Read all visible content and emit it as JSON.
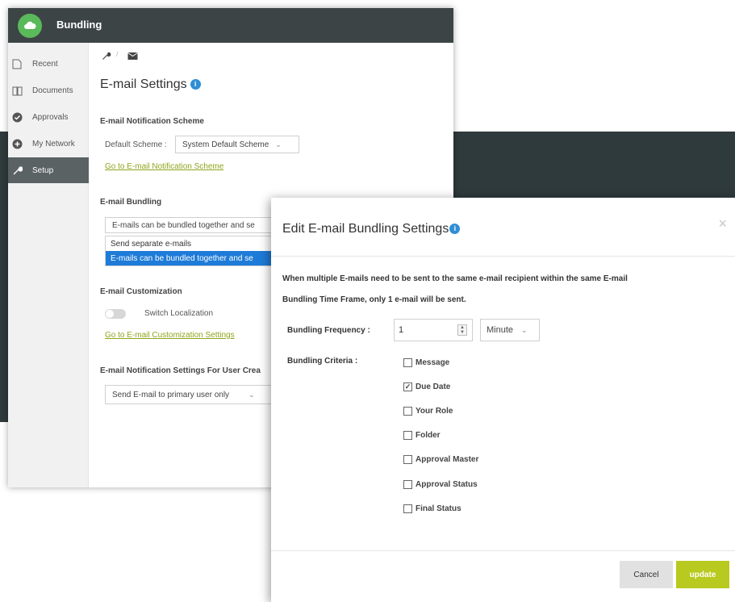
{
  "app": {
    "title": "Bundling"
  },
  "sidebar": {
    "items": [
      {
        "label": "Recent",
        "icon": "file-icon"
      },
      {
        "label": "Documents",
        "icon": "book-icon"
      },
      {
        "label": "Approvals",
        "icon": "check-circle-icon"
      },
      {
        "label": "My Network",
        "icon": "plus-circle-icon"
      },
      {
        "label": "Setup",
        "icon": "wrench-icon",
        "active": true
      }
    ]
  },
  "toolbar": {
    "icons": [
      "wrench-icon",
      "mail-icon"
    ]
  },
  "email_settings": {
    "title": "E-mail Settings",
    "notification_scheme": {
      "section_title": "E-mail Notification Scheme",
      "default_label": "Default Scheme :",
      "default_value": "System Default Scheme",
      "link": "Go to E-mail Notification Scheme"
    },
    "bundling": {
      "section_title": "E-mail Bundling",
      "select_value": "E-mails can be bundled together and se",
      "options": [
        "Send separate e-mails",
        "E-mails can be bundled together and se"
      ],
      "selected_index": 1
    },
    "customization": {
      "section_title": "E-mail Customization",
      "toggle_label": "Switch Localization",
      "toggle_on": false,
      "link": "Go to E-mail Customization Settings"
    },
    "user_creation": {
      "section_title": "E-mail Notification Settings For User Crea",
      "select_value": "Send E-mail to primary user only"
    }
  },
  "modal": {
    "title": "Edit E-mail Bundling Settings",
    "description_line1": "When multiple E-mails need to be sent to the same e-mail recipient within the same E-mail",
    "description_line2": "Bundling Time Frame, only 1 e-mail will be sent.",
    "frequency_label": "Bundling Frequency :",
    "frequency_value": "1",
    "frequency_unit": "Minute",
    "criteria_label": "Bundling Criteria :",
    "criteria": [
      {
        "label": "Message",
        "checked": false
      },
      {
        "label": "Due Date",
        "checked": true
      },
      {
        "label": "Your Role",
        "checked": false
      },
      {
        "label": "Folder",
        "checked": false
      },
      {
        "label": "Approval Master",
        "checked": false
      },
      {
        "label": "Approval Status",
        "checked": false
      },
      {
        "label": "Final Status",
        "checked": false
      }
    ],
    "cancel_label": "Cancel",
    "update_label": "update",
    "close_glyph": "×"
  },
  "colors": {
    "topbar": "#3d4446",
    "logo": "#5ab95a",
    "accent_link": "#8ea51c",
    "update_button": "#b8c91f",
    "selected_option": "#1e7bd8",
    "info": "#2f8fd6"
  }
}
